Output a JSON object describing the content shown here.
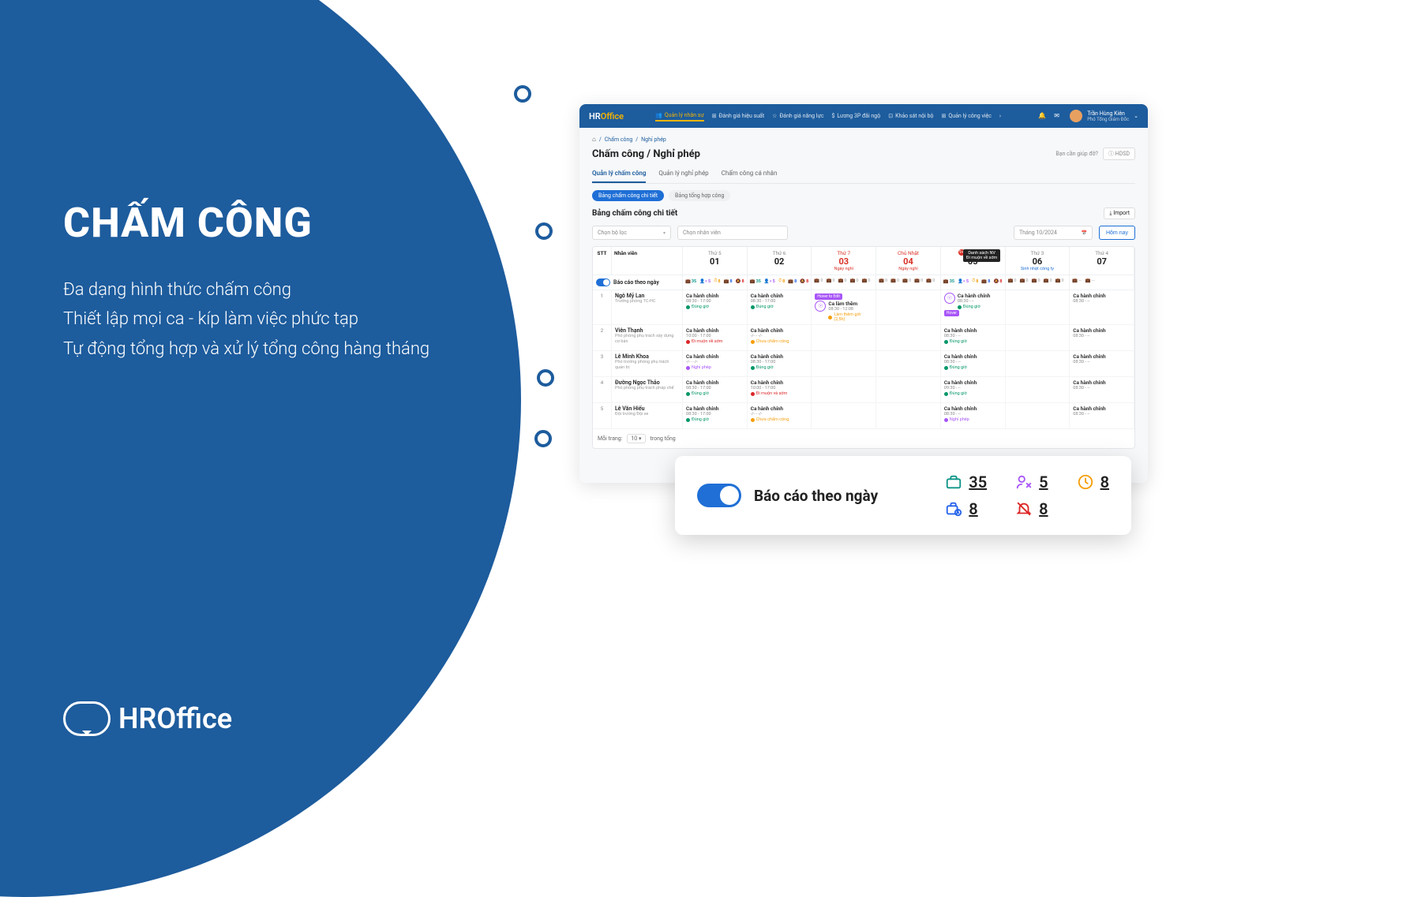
{
  "marketing": {
    "title": "CHẤM CÔNG",
    "line1": "Đa dạng hình thức chấm công",
    "line2": "Thiết lập mọi ca - kíp làm việc phức tạp",
    "line3": "Tự động tổng hợp và xử lý tổng công hàng tháng",
    "brand": "HROffice"
  },
  "app": {
    "logo_hr": "HR",
    "logo_office": "Office",
    "nav": [
      "Quản lý nhân sự",
      "Đánh giá hiệu suất",
      "Đánh giá năng lực",
      "Lương 3P đãi ngộ",
      "Khảo sát nội bộ",
      "Quản lý công việc"
    ],
    "user": {
      "name": "Trần Hùng Kiên",
      "role": "Phó Tổng Giám Đốc"
    },
    "breadcrumb": {
      "section": "Chấm công",
      "page": "Nghỉ phép"
    },
    "page_title": "Chấm công / Nghỉ phép",
    "help_text": "Bạn cần giúp đỡ?",
    "help_btn": "HDSD",
    "tabs": [
      "Quản lý chấm công",
      "Quản lý nghỉ phép",
      "Chấm công cá nhân"
    ],
    "pills": [
      "Bảng chấm công chi tiết",
      "Bảng tổng hợp công"
    ],
    "section_title": "Bảng chấm công chi tiết",
    "import_btn": "Import",
    "filters": {
      "filter_placeholder": "Chọn bộ lọc",
      "employee_placeholder": "Chọn nhân viên",
      "month": "Tháng 10/2024",
      "today": "Hôm nay"
    },
    "cols": {
      "stt": "STT",
      "emp": "Nhân viên"
    },
    "days": [
      {
        "dow": "Thứ 5",
        "num": "01",
        "sub": ""
      },
      {
        "dow": "Thứ 6",
        "num": "02",
        "sub": ""
      },
      {
        "dow": "Thứ 7",
        "num": "03",
        "sub": "Ngày nghỉ",
        "red": true
      },
      {
        "dow": "Chủ Nhật",
        "num": "04",
        "sub": "Ngày nghỉ",
        "red": true
      },
      {
        "dow": "Thứ 2",
        "num": "05",
        "sub": "",
        "tooltip": "Danh sách NV\nĐi muộn về sớm",
        "badge": "9+"
      },
      {
        "dow": "Thứ 3",
        "num": "06",
        "sub": "Sinh nhật công ty",
        "blue": true
      },
      {
        "dow": "Thứ 4",
        "num": "07",
        "sub": ""
      }
    ],
    "toggle_label": "Báo cáo theo ngày",
    "stats_cols": [
      [
        {
          "c": "teal",
          "n": "35"
        },
        {
          "c": "purple",
          "n": "5"
        },
        {
          "c": "orange",
          "n": "8"
        },
        {
          "c": "blue",
          "n": "8"
        },
        {
          "c": "red",
          "n": "8"
        }
      ],
      [
        {
          "c": "teal",
          "n": "35"
        },
        {
          "c": "purple",
          "n": "5"
        },
        {
          "c": "orange",
          "n": "8"
        },
        {
          "c": "blue",
          "n": "8"
        },
        {
          "c": "red",
          "n": "8"
        }
      ],
      [
        {
          "c": "gray",
          "n": "0"
        },
        {
          "c": "gray",
          "n": "0"
        },
        {
          "c": "gray",
          "n": "0"
        },
        {
          "c": "gray",
          "n": "0"
        },
        {
          "c": "gray",
          "n": "0"
        }
      ],
      [
        {
          "c": "gray",
          "n": "0"
        },
        {
          "c": "gray",
          "n": "0"
        },
        {
          "c": "gray",
          "n": "0"
        },
        {
          "c": "gray",
          "n": "0"
        },
        {
          "c": "gray",
          "n": "0"
        }
      ],
      [
        {
          "c": "teal",
          "n": "35"
        },
        {
          "c": "purple",
          "n": "5"
        },
        {
          "c": "orange",
          "n": "8"
        },
        {
          "c": "blue",
          "n": "8"
        },
        {
          "c": "red",
          "n": "8"
        }
      ],
      [
        {
          "c": "gray",
          "n": "0"
        },
        {
          "c": "gray",
          "n": "0"
        },
        {
          "c": "gray",
          "n": "0"
        },
        {
          "c": "gray",
          "n": "0"
        },
        {
          "c": "gray",
          "n": "0"
        }
      ],
      [
        {
          "c": "gray",
          "n": "--"
        },
        {
          "c": "gray",
          "n": "--"
        }
      ]
    ],
    "hover_tip": "Hover to Edit",
    "rows": [
      {
        "idx": "1",
        "name": "Ngô Mỹ Lan",
        "role": "Trưởng phòng TC-HC",
        "cells": [
          {
            "sh": "Ca hành chính",
            "t": "08:30 - 17:00",
            "st": "Đúng giờ",
            "cls": "green"
          },
          {
            "sh": "Ca hành chính",
            "t": "08:30 - 17:00",
            "st": "Đúng giờ",
            "cls": "green"
          },
          {
            "sh": "Ca làm thêm",
            "t": "08:30 - 12:08",
            "st": "Làm thêm giờ (2,5h)",
            "cls": "orange",
            "fp": true,
            "hover": true
          },
          {
            "blank": true
          },
          {
            "sh": "Ca hành chính",
            "t": "08:30 - -- ",
            "st": "Đúng giờ",
            "cls": "green",
            "fp": true,
            "hover_label": "Hover"
          },
          {
            "blank": true
          },
          {
            "sh": "Ca hành chính",
            "t": "08:30 - --"
          }
        ]
      },
      {
        "idx": "2",
        "name": "Viên Thạnh",
        "role": "Phó phòng phụ trách xây dựng cơ bản",
        "cells": [
          {
            "sh": "Ca hành chính",
            "t": "10:00 - 17:00",
            "st": "Đi muộn về sớm",
            "cls": "red"
          },
          {
            "sh": "Ca hành chính",
            "t": "-/- - -/-",
            "st": "Chưa chấm công",
            "cls": "orange"
          },
          {
            "blank": true
          },
          {
            "blank": true
          },
          {
            "sh": "Ca hành chính",
            "t": "08:30 - --",
            "st": "Đúng giờ",
            "cls": "green"
          },
          {
            "blank": true
          },
          {
            "sh": "Ca hành chính",
            "t": "08:30 - --"
          }
        ]
      },
      {
        "idx": "3",
        "name": "Lê Minh Khoa",
        "role": "Phó trưởng phòng phụ trách quản trị",
        "cells": [
          {
            "sh": "Ca hành chính",
            "t": "-/- - -/-",
            "st": "Nghỉ phép",
            "cls": "purple"
          },
          {
            "sh": "Ca hành chính",
            "t": "08:30 - 17:00",
            "st": "Đúng giờ",
            "cls": "green"
          },
          {
            "blank": true
          },
          {
            "blank": true
          },
          {
            "sh": "Ca hành chính",
            "t": "08:30 - --",
            "st": "Đúng giờ",
            "cls": "green"
          },
          {
            "blank": true
          },
          {
            "sh": "Ca hành chính",
            "t": "08:30 - --"
          }
        ]
      },
      {
        "idx": "4",
        "name": "Đường Ngọc Thảo",
        "role": "Phó phòng phụ trách pháp chế",
        "cells": [
          {
            "sh": "Ca hành chính",
            "t": "08:30 - 17:00",
            "st": "Đúng giờ",
            "cls": "green"
          },
          {
            "sh": "Ca hành chính",
            "t": "10:00 - 17:00",
            "st": "Đi muộn và sớm",
            "cls": "red"
          },
          {
            "blank": true
          },
          {
            "blank": true
          },
          {
            "sh": "Ca hành chính",
            "t": "09:30 - --",
            "st": "Đúng giờ",
            "cls": "green"
          },
          {
            "blank": true
          },
          {
            "sh": "Ca hành chính",
            "t": "08:30 - --"
          }
        ]
      },
      {
        "idx": "5",
        "name": "Lê Văn Hiếu",
        "role": "Đội trưởng Đội xe",
        "cells": [
          {
            "sh": "Ca hành chính",
            "t": "08:30 - 17:00",
            "st": "Đúng giờ",
            "cls": "green"
          },
          {
            "sh": "Ca hành chính",
            "t": "-/- - -/-",
            "st": "Chưa chấm công",
            "cls": "orange"
          },
          {
            "blank": true
          },
          {
            "blank": true
          },
          {
            "sh": "Ca hành chính",
            "t": "08:30 - --",
            "st": "Nghỉ phép",
            "cls": "purple"
          },
          {
            "blank": true
          },
          {
            "sh": "Ca hành chính",
            "t": "08:30 - --"
          }
        ]
      }
    ],
    "pager": {
      "per_label": "Mỗi trang:",
      "per_value": "10",
      "total_label": "trong tổng"
    }
  },
  "zoom": {
    "label": "Báo cáo theo ngày",
    "stats": [
      {
        "icon": "briefcase",
        "color": "zi-brief",
        "n": "35"
      },
      {
        "icon": "user-x",
        "color": "zi-ux",
        "n": "5"
      },
      {
        "icon": "clock",
        "color": "zi-clock",
        "n": "8"
      },
      {
        "icon": "briefcase-clock",
        "color": "zi-brief2",
        "n": "8"
      },
      {
        "icon": "bell-off",
        "color": "zi-bell",
        "n": "8"
      }
    ]
  }
}
